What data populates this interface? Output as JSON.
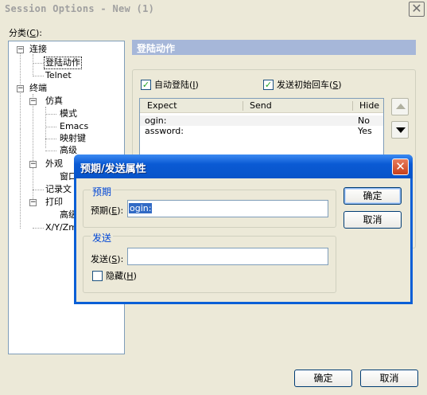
{
  "window": {
    "title": "Session Options - New (1)",
    "close_glyph": "✕"
  },
  "categories_label": {
    "text": "分类(",
    "accel": "C",
    "suffix": "):"
  },
  "tree": {
    "connection": "连接",
    "login_actions": "登陆动作",
    "telnet": "Telnet",
    "terminal": "终端",
    "emulation": "仿真",
    "modes": "模式",
    "emacs": "Emacs",
    "mapped_keys": "映射键",
    "advanced": "高级",
    "appearance": "外观",
    "window": "窗口",
    "log_file": "记录文",
    "printing": "打印",
    "print_advanced": "高级",
    "xyzmodem": "X/Y/Zmo",
    "collapse_glyph": "−",
    "expand_glyph": "+"
  },
  "section": {
    "title": "登陆动作"
  },
  "options": {
    "auto_login": {
      "label": "自动登陆(",
      "accel": "I",
      "suffix": ")",
      "checked": true
    },
    "send_initial_cr": {
      "label": "发送初始回车(",
      "accel": "S",
      "suffix": ")",
      "checked": true
    },
    "check_glyph": "✓"
  },
  "list": {
    "columns": [
      "Expect",
      "Send",
      "Hide"
    ],
    "rows": [
      {
        "expect": "ogin:",
        "send": "",
        "hide": "No"
      },
      {
        "expect": "assword:",
        "send": "",
        "hide": "Yes"
      }
    ]
  },
  "buttons": {
    "ok": "确定",
    "cancel": "取消"
  },
  "dialog": {
    "title": "预期/发送属性",
    "close_glyph": "✕",
    "expect_group": "预期",
    "expect_label": {
      "text": "预期(",
      "accel": "E",
      "suffix": "):"
    },
    "expect_value": "ogin:",
    "send_group": "发送",
    "send_label": {
      "text": "发送(",
      "accel": "S",
      "suffix": "):"
    },
    "send_value": "",
    "hide": {
      "label": "隐藏(",
      "accel": "H",
      "suffix": ")",
      "checked": false
    },
    "ok": "确定",
    "cancel": "取消"
  },
  "colors": {
    "section_header": "#a6b7d9",
    "dialog_title": "#0a5ad4",
    "legend": "#0046d5",
    "selection": "#316ac5"
  }
}
